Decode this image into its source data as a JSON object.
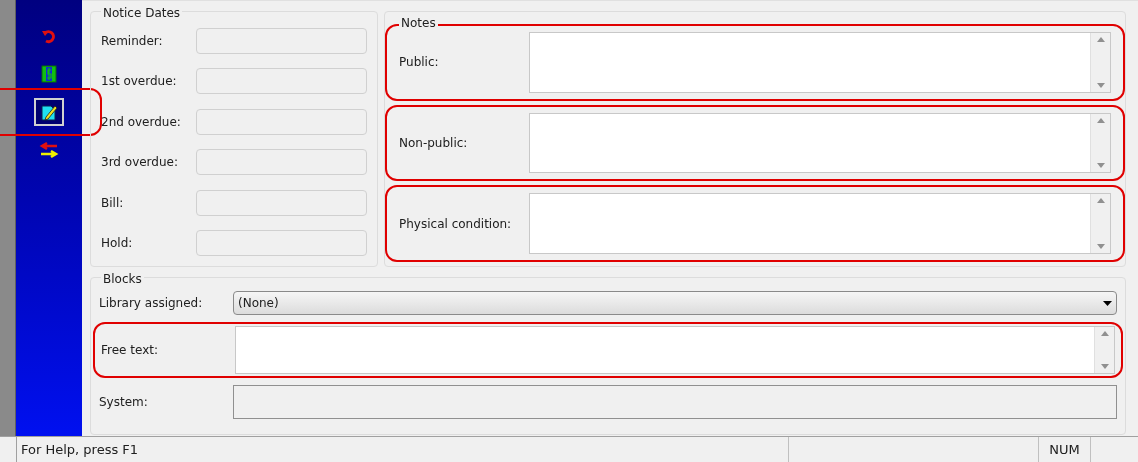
{
  "sidebar": {
    "items": [
      {
        "kind": "undo",
        "selected": false,
        "highlighted": false
      },
      {
        "kind": "money",
        "selected": false,
        "highlighted": false
      },
      {
        "kind": "note",
        "selected": true,
        "highlighted": true
      },
      {
        "kind": "swap",
        "selected": false,
        "highlighted": false
      }
    ]
  },
  "notice_dates": {
    "title": "Notice Dates",
    "fields": [
      {
        "label": "Reminder:",
        "disabled": true
      },
      {
        "label": "1st overdue:",
        "disabled": true
      },
      {
        "label": "2nd overdue:",
        "disabled": true
      },
      {
        "label": "3rd overdue:",
        "disabled": true
      },
      {
        "label": "Bill:",
        "disabled": true
      },
      {
        "label": "Hold:",
        "disabled": true
      }
    ]
  },
  "notes": {
    "title": "Notes",
    "fields": [
      {
        "label": "Public:",
        "highlighted": true
      },
      {
        "label": "Non-public:",
        "highlighted": true
      },
      {
        "label": "Physical condition:",
        "highlighted": true
      }
    ]
  },
  "blocks": {
    "title": "Blocks",
    "library_assigned": {
      "label": "Library assigned:",
      "value": "(None)"
    },
    "free_text": {
      "label": "Free text:",
      "highlighted": true
    },
    "system": {
      "label": "System:",
      "disabled": true
    }
  },
  "status_bar": {
    "message": "For Help, press F1",
    "indicator": "NUM"
  }
}
